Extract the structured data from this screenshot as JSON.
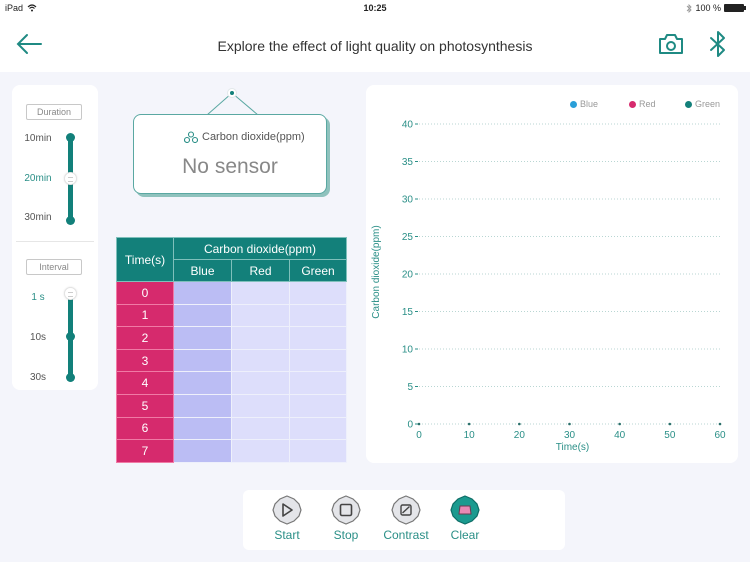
{
  "statusbar": {
    "device": "iPad",
    "time": "10:25",
    "battery": "100 %"
  },
  "header": {
    "title": "Explore the effect of light quality on photosynthesis"
  },
  "duration": {
    "label": "Duration",
    "options": [
      "10min",
      "20min",
      "30min"
    ],
    "selected": "20min"
  },
  "interval": {
    "label": "Interval",
    "options": [
      "1 s",
      "10s",
      "30s"
    ],
    "selected": "1 s"
  },
  "sensor": {
    "name": "Carbon dioxide(ppm)",
    "value": "No sensor"
  },
  "table": {
    "time_header": "Time(s)",
    "group_header": "Carbon dioxide(ppm)",
    "columns": [
      "Blue",
      "Red",
      "Green"
    ],
    "rows": [
      {
        "time": "0",
        "blue": "",
        "red": "",
        "green": ""
      },
      {
        "time": "1",
        "blue": "",
        "red": "",
        "green": ""
      },
      {
        "time": "2",
        "blue": "",
        "red": "",
        "green": ""
      },
      {
        "time": "3",
        "blue": "",
        "red": "",
        "green": ""
      },
      {
        "time": "4",
        "blue": "",
        "red": "",
        "green": ""
      },
      {
        "time": "5",
        "blue": "",
        "red": "",
        "green": ""
      },
      {
        "time": "6",
        "blue": "",
        "red": "",
        "green": ""
      },
      {
        "time": "7",
        "blue": "",
        "red": "",
        "green": ""
      }
    ]
  },
  "chart_data": {
    "type": "line",
    "title": "",
    "xlabel": "Time(s)",
    "ylabel": "Carbon dioxide(ppm)",
    "xlim": [
      0,
      60
    ],
    "ylim": [
      0,
      40
    ],
    "xticks": [
      0,
      10,
      20,
      30,
      40,
      50,
      60
    ],
    "yticks": [
      0,
      5,
      10,
      15,
      20,
      25,
      30,
      35,
      40
    ],
    "grid": true,
    "legend_position": "top-right",
    "series": [
      {
        "name": "Blue",
        "color": "#2a9fd8",
        "x": [],
        "y": []
      },
      {
        "name": "Red",
        "color": "#d62a6d",
        "x": [],
        "y": []
      },
      {
        "name": "Green",
        "color": "#13807a",
        "x": [],
        "y": []
      }
    ]
  },
  "actions": [
    {
      "id": "start",
      "label": "Start",
      "icon": "play-icon"
    },
    {
      "id": "stop",
      "label": "Stop",
      "icon": "stop-icon"
    },
    {
      "id": "contrast",
      "label": "Contrast",
      "icon": "contrast-icon"
    },
    {
      "id": "clear",
      "label": "Clear",
      "icon": "eraser-icon"
    }
  ],
  "colors": {
    "accent": "#13807a",
    "time_column": "#d62a6d",
    "blue_column": "#bbbdf4",
    "other_columns": "#dddefb"
  }
}
